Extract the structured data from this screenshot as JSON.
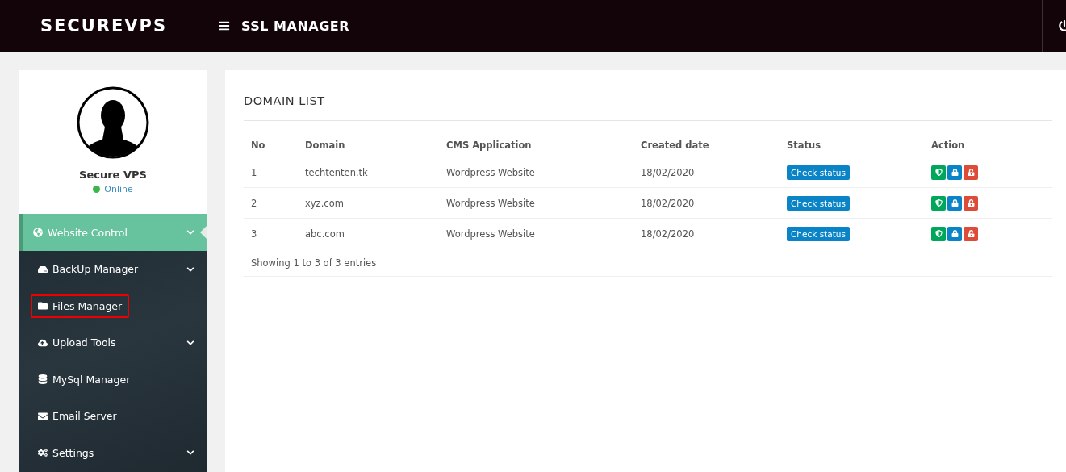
{
  "header": {
    "brand": "SECUREVPS",
    "title": "SSL MANAGER"
  },
  "profile": {
    "name": "Secure VPS",
    "status": "Online",
    "online": true
  },
  "sidebar": {
    "items": [
      {
        "label": "Website Control",
        "selected": true,
        "expandable": true,
        "highlighted": false
      },
      {
        "label": "BackUp Manager",
        "selected": false,
        "expandable": true,
        "highlighted": false
      },
      {
        "label": "Files Manager",
        "selected": false,
        "expandable": false,
        "highlighted": true
      },
      {
        "label": "Upload Tools",
        "selected": false,
        "expandable": true,
        "highlighted": false
      },
      {
        "label": "MySql Manager",
        "selected": false,
        "expandable": false,
        "highlighted": false
      },
      {
        "label": "Email Server",
        "selected": false,
        "expandable": false,
        "highlighted": false
      },
      {
        "label": "Settings",
        "selected": false,
        "expandable": true,
        "highlighted": false
      }
    ]
  },
  "panel": {
    "title": "DOMAIN LIST",
    "table": {
      "columns": [
        "No",
        "Domain",
        "CMS Application",
        "Created date",
        "Status",
        "Action"
      ],
      "rows": [
        {
          "no": "1",
          "domain": "techtenten.tk",
          "cms": "Wordpress Website",
          "created": "18/02/2020",
          "status_button": "Check status"
        },
        {
          "no": "2",
          "domain": "xyz.com",
          "cms": "Wordpress Website",
          "created": "18/02/2020",
          "status_button": "Check status"
        },
        {
          "no": "3",
          "domain": "abc.com",
          "cms": "Wordpress Website",
          "created": "18/02/2020",
          "status_button": "Check status"
        }
      ]
    },
    "footer": "Showing 1 to 3 of 3 entries"
  }
}
